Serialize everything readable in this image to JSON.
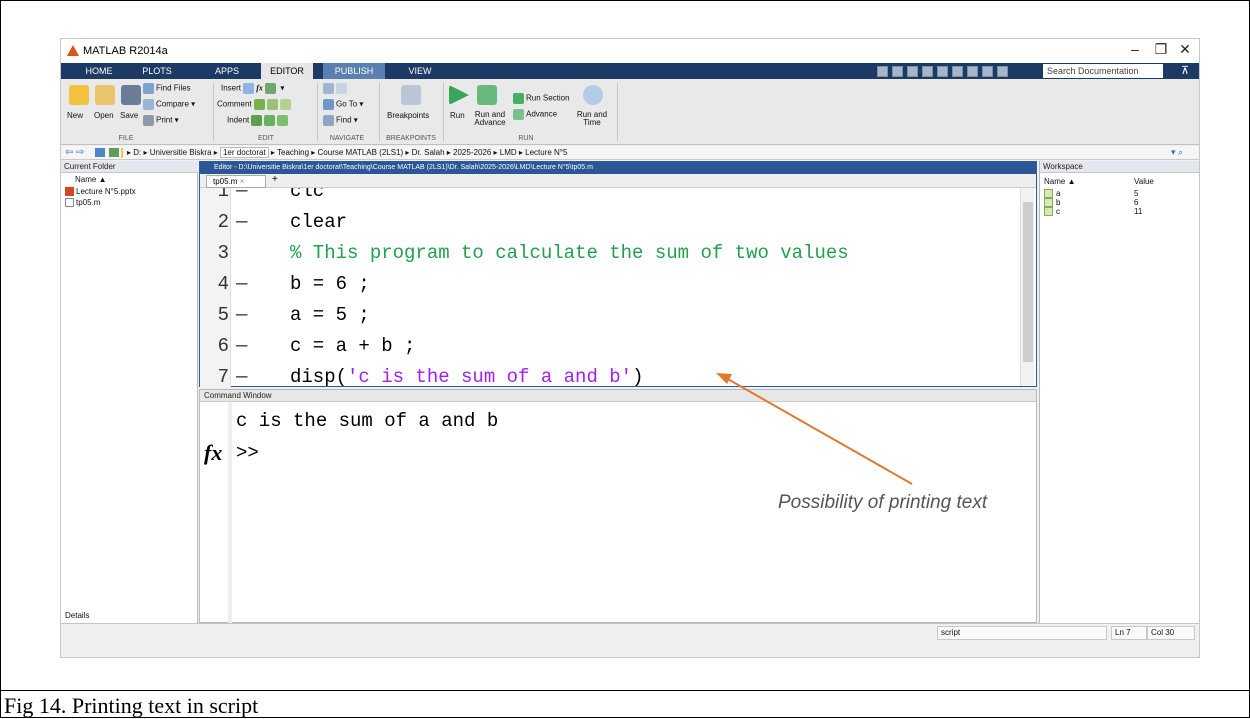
{
  "window": {
    "title": "MATLAB R2014a",
    "minimize": "–",
    "restore": "❐",
    "close": "✕"
  },
  "tabs": [
    "HOME",
    "PLOTS",
    "APPS",
    "EDITOR",
    "PUBLISH",
    "VIEW"
  ],
  "active_tab": "EDITOR",
  "search": {
    "placeholder": "Search Documentation"
  },
  "ribbon": {
    "file": {
      "new": "New",
      "open": "Open",
      "save": "Save",
      "find_files": "Find Files",
      "compare": "Compare",
      "print": "Print",
      "label": "FILE"
    },
    "edit": {
      "insert": "Insert",
      "comment": "Comment",
      "indent": "Indent",
      "label": "EDIT"
    },
    "navigate": {
      "goto": "Go To",
      "find": "Find",
      "label": "NAVIGATE"
    },
    "breakpoints": {
      "breakpoints": "Breakpoints",
      "label": "BREAKPOINTS"
    },
    "run": {
      "run": "Run",
      "run_advance": "Run and Advance",
      "run_section": "Run Section",
      "advance": "Advance",
      "run_time": "Run and Time",
      "label": "RUN"
    }
  },
  "address": {
    "crumbs": [
      "D:",
      "Universitie Biskra",
      "1er doctorat",
      "Teaching",
      "Course MATLAB (2LS1)",
      "Dr. Salah",
      "2025-2026",
      "LMD",
      "Lecture N°5"
    ]
  },
  "current_folder": {
    "title": "Current Folder",
    "column": "Name ▲",
    "files": [
      "Lecture N°5.pptx",
      "tp05.m"
    ],
    "details": "Details"
  },
  "editor": {
    "title": "Editor - D:\\Universitie Biskra\\1er doctorat\\Teaching\\Course MATLAB (2LS1)\\Dr. Salah\\2025-2026\\LMD\\Lecture N°5\\tp05.m",
    "file_tab": "tp05.m",
    "lines": [
      {
        "n": "1",
        "bp": "—",
        "parts": [
          {
            "t": "clc",
            "c": ""
          }
        ]
      },
      {
        "n": "2",
        "bp": "—",
        "parts": [
          {
            "t": "clear",
            "c": ""
          }
        ]
      },
      {
        "n": "3",
        "bp": "",
        "parts": [
          {
            "t": "% This program to calculate the sum of two values",
            "c": "cmt"
          }
        ]
      },
      {
        "n": "4",
        "bp": "—",
        "parts": [
          {
            "t": "b = 6 ;",
            "c": ""
          }
        ]
      },
      {
        "n": "5",
        "bp": "—",
        "parts": [
          {
            "t": "a = 5 ;",
            "c": ""
          }
        ]
      },
      {
        "n": "6",
        "bp": "—",
        "parts": [
          {
            "t": "c = a + b ;",
            "c": ""
          }
        ]
      },
      {
        "n": "7",
        "bp": "—",
        "parts": [
          {
            "t": "disp(",
            "c": ""
          },
          {
            "t": "'c is the sum of a and b'",
            "c": "str"
          },
          {
            "t": ")",
            "c": ""
          }
        ]
      }
    ]
  },
  "command_window": {
    "title": "Command Window",
    "output": "c is the sum of a and b",
    "fx": "fx",
    "prompt": ">>"
  },
  "workspace": {
    "title": "Workspace",
    "col_name": "Name ▲",
    "col_value": "Value",
    "vars": [
      {
        "name": "a",
        "value": "5"
      },
      {
        "name": "b",
        "value": "6"
      },
      {
        "name": "c",
        "value": "11"
      }
    ]
  },
  "status": {
    "mode": "script",
    "ln": "Ln  7",
    "col": "Col  30"
  },
  "annotation": "Possibility of printing text",
  "caption": "Fig 14. Printing text in script"
}
